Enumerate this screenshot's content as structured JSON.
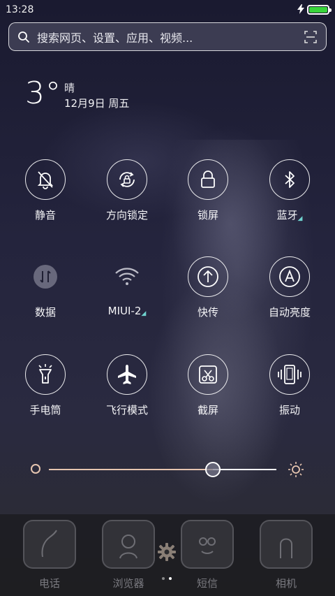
{
  "status_bar": {
    "time": "13:28"
  },
  "search": {
    "placeholder": "搜索网页、设置、应用、视频..."
  },
  "weather": {
    "temp": "3°",
    "condition": "晴",
    "date": "12月9日 周五"
  },
  "toggles": [
    {
      "label": "静音",
      "icon": "bell-off-icon"
    },
    {
      "label": "方向锁定",
      "icon": "rotation-lock-icon"
    },
    {
      "label": "锁屏",
      "icon": "lock-icon"
    },
    {
      "label": "蓝牙",
      "icon": "bluetooth-icon"
    },
    {
      "label": "数据",
      "icon": "data-icon"
    },
    {
      "label": "MIUI-2",
      "icon": "wifi-icon"
    },
    {
      "label": "快传",
      "icon": "upload-icon"
    },
    {
      "label": "自动亮度",
      "icon": "auto-brightness-icon"
    },
    {
      "label": "手电筒",
      "icon": "flashlight-icon"
    },
    {
      "label": "飞行模式",
      "icon": "airplane-icon"
    },
    {
      "label": "截屏",
      "icon": "screenshot-icon"
    },
    {
      "label": "振动",
      "icon": "vibrate-icon"
    }
  ],
  "brightness": {
    "level": 0.72
  },
  "dock": {
    "apps": [
      {
        "label": "电话"
      },
      {
        "label": "浏览器"
      },
      {
        "label": "短信"
      },
      {
        "label": "相机"
      }
    ]
  },
  "colors": {
    "battery": "#39d53b",
    "accent_corner": "#6fd3cf",
    "slider_fill": "#e6c5b0"
  }
}
